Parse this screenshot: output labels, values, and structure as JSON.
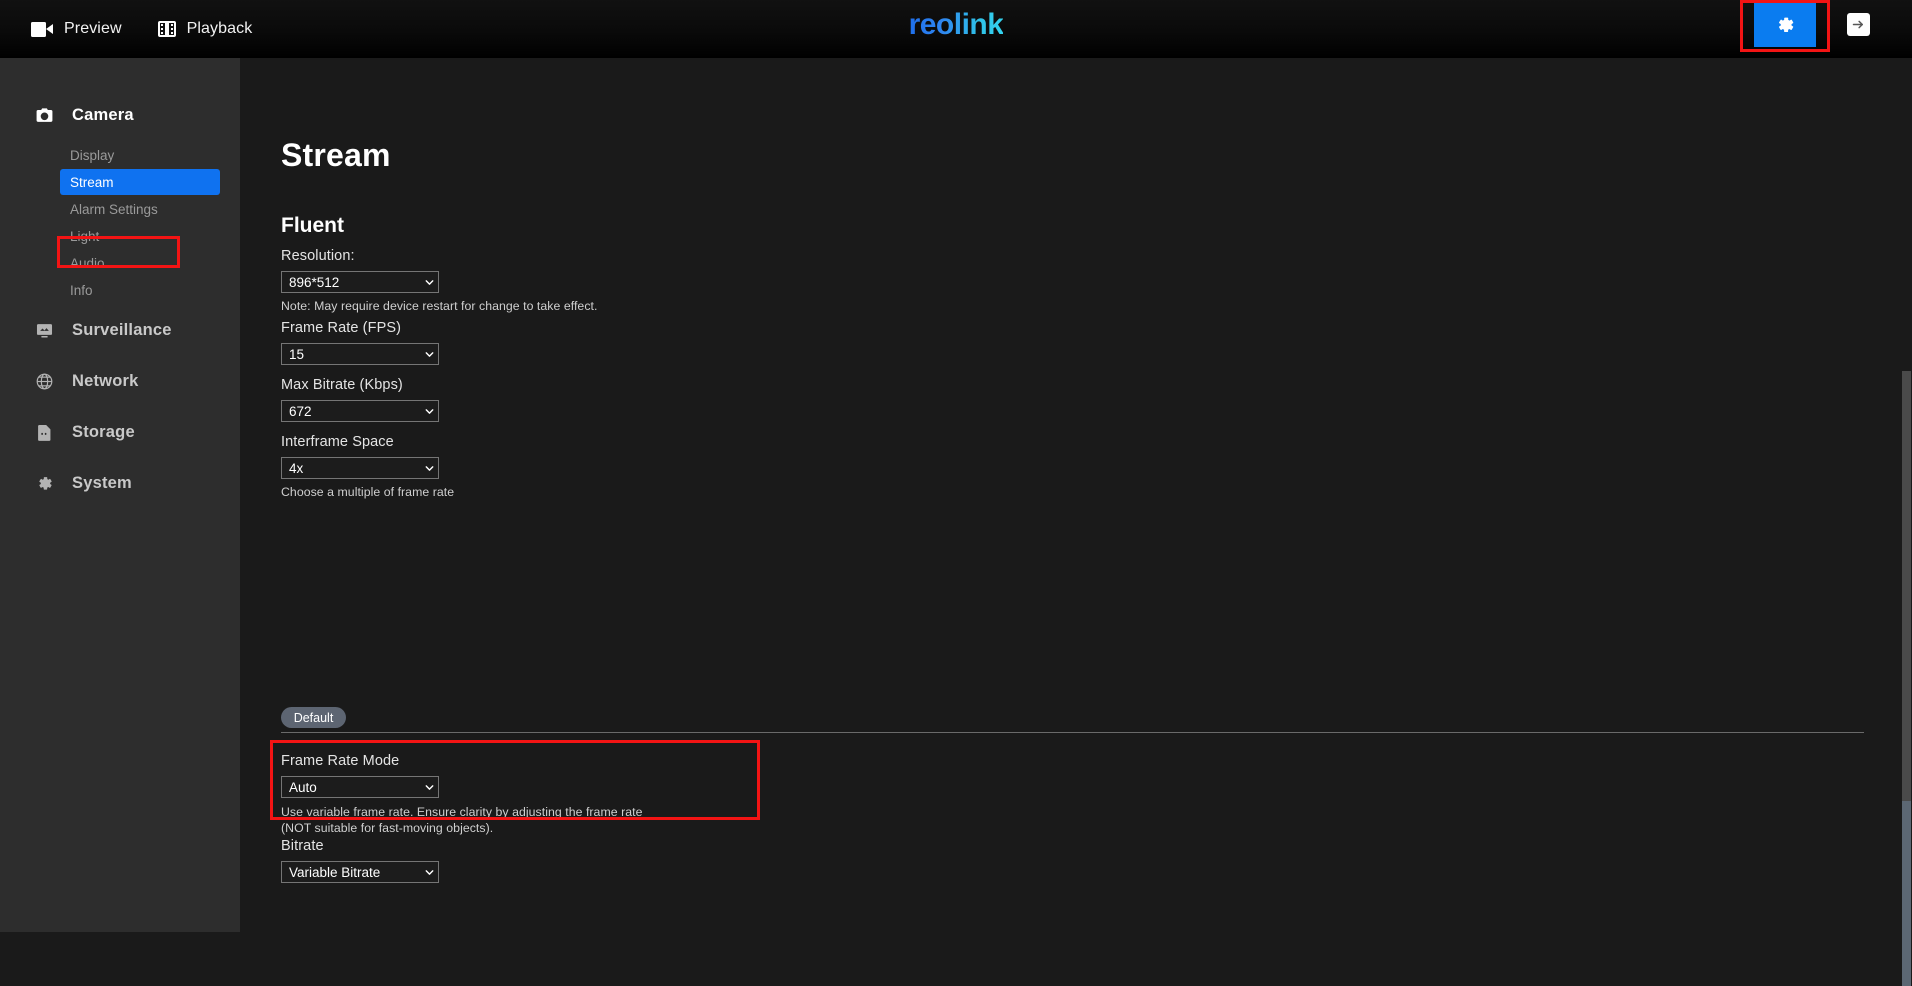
{
  "topbar": {
    "nav": [
      {
        "label": "Preview",
        "icon": "video-camera-icon"
      },
      {
        "label": "Playback",
        "icon": "film-strip-icon"
      }
    ],
    "brand": "reolink",
    "settings_icon": "gear-icon",
    "logout_icon": "exit-arrow-icon",
    "accent_color": "#0a7cf0",
    "annotation_color": "#f31414"
  },
  "sidebar": {
    "groups": [
      {
        "label": "Camera",
        "icon": "camera-icon",
        "active": true,
        "items": [
          {
            "label": "Display",
            "selected": false
          },
          {
            "label": "Stream",
            "selected": true
          },
          {
            "label": "Alarm Settings",
            "selected": false
          },
          {
            "label": "Light",
            "selected": false
          },
          {
            "label": "Audio",
            "selected": false
          },
          {
            "label": "Info",
            "selected": false
          }
        ]
      },
      {
        "label": "Surveillance",
        "icon": "monitor-icon",
        "active": false,
        "items": []
      },
      {
        "label": "Network",
        "icon": "globe-icon",
        "active": false,
        "items": []
      },
      {
        "label": "Storage",
        "icon": "sdcard-icon",
        "active": false,
        "items": []
      },
      {
        "label": "System",
        "icon": "gear-icon",
        "active": false,
        "items": []
      }
    ]
  },
  "main": {
    "page_title": "Stream",
    "section_title": "Fluent",
    "fields": {
      "resolution": {
        "label": "Resolution:",
        "value": "896*512",
        "hint": "Note: May require device restart for change to take effect."
      },
      "frame_rate": {
        "label": "Frame Rate (FPS)",
        "value": "15",
        "hint": ""
      },
      "max_bitrate": {
        "label": "Max Bitrate (Kbps)",
        "value": "672",
        "hint": ""
      },
      "interframe_space": {
        "label": "Interframe Space",
        "value": "4x",
        "hint": "Choose a multiple of frame rate"
      },
      "frame_rate_mode": {
        "label": "Frame Rate Mode",
        "value": "Auto",
        "hint": "Use variable frame rate. Ensure clarity by adjusting the frame rate (NOT suitable for fast-moving objects)."
      },
      "bitrate": {
        "label": "Bitrate",
        "value": "Variable Bitrate",
        "hint": ""
      }
    },
    "default_button": "Default"
  }
}
